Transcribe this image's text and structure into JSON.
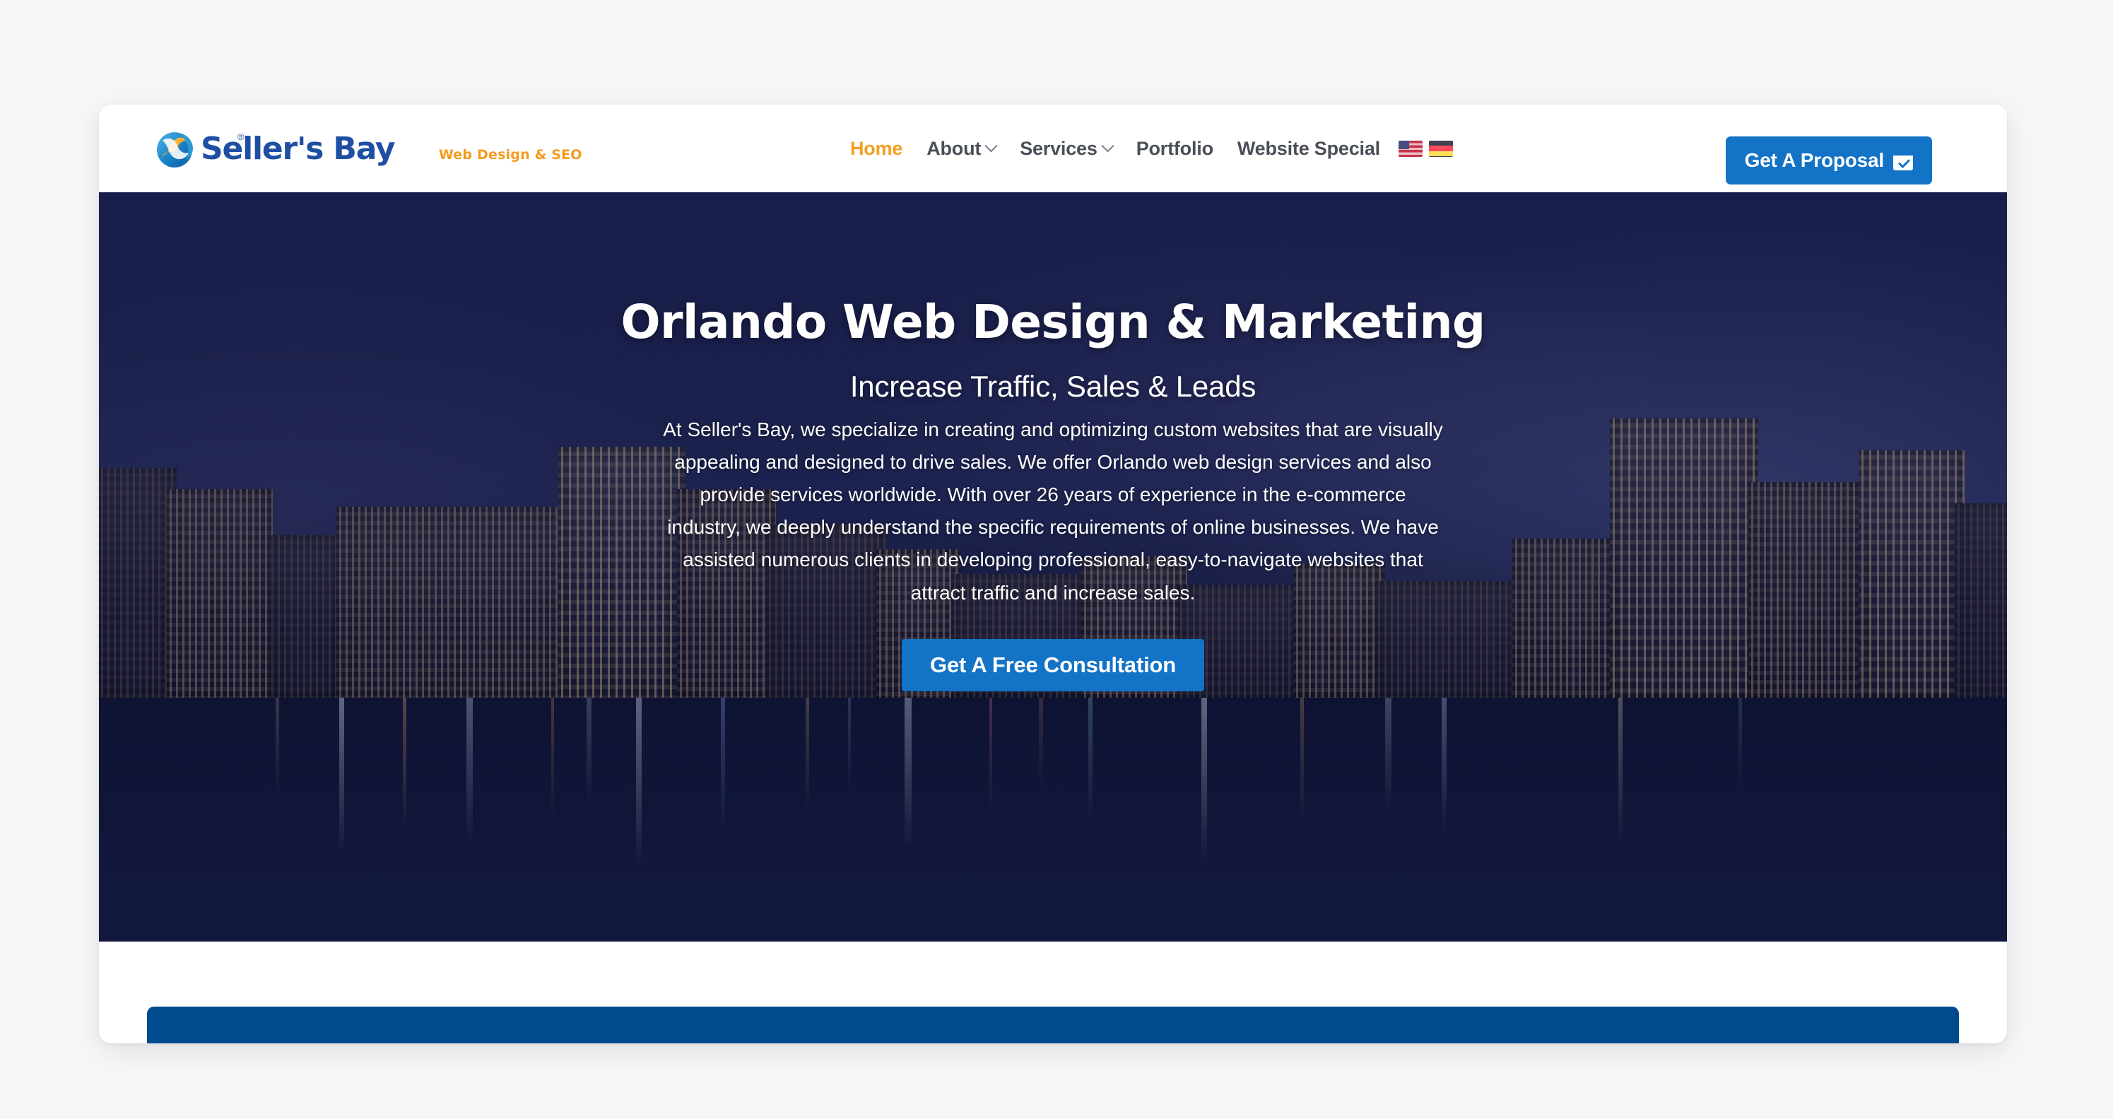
{
  "brand": {
    "name": "Seller's Bay",
    "tagline": "Web Design & SEO",
    "registered_mark": "®",
    "logo_icon": "sellers-bay-globe-swoosh",
    "name_color": "#1f4fa3",
    "tagline_color": "#f59a1e"
  },
  "header": {
    "nav": [
      {
        "label": "Home",
        "active": true,
        "has_dropdown": false
      },
      {
        "label": "About",
        "active": false,
        "has_dropdown": true
      },
      {
        "label": "Services",
        "active": false,
        "has_dropdown": true
      },
      {
        "label": "Portfolio",
        "active": false,
        "has_dropdown": false
      },
      {
        "label": "Website Special",
        "active": false,
        "has_dropdown": false
      }
    ],
    "languages": [
      {
        "name": "english",
        "icon": "us-flag-icon"
      },
      {
        "name": "german",
        "icon": "german-flag-icon"
      }
    ],
    "cta": {
      "label": "Get A Proposal",
      "icon": "calendar-check-icon",
      "color": "#1373c6"
    },
    "active_color": "#f0a020",
    "nav_color": "#4a4f58"
  },
  "hero": {
    "title": "Orlando Web Design & Marketing",
    "subtitle": "Increase Traffic, Sales & Leads",
    "paragraph": "At Seller's Bay, we specialize in creating and optimizing custom websites that are visually appealing and designed to drive sales. We offer Orlando web design services and also provide services worldwide. With over 26 years of experience in the e-commerce industry, we deeply understand the specific requirements of online businesses. We have assisted numerous clients in developing professional, easy-to-navigate websites that attract traffic and increase sales.",
    "cta_label": "Get A Free Consultation",
    "cta_color": "#1373c6",
    "scroll_icon": "chevron-down-circle-icon",
    "background_image": "orlando-downtown-skyline-at-night-reflected-in-lake-eola",
    "background_color": "#1a2150"
  },
  "next_section": {
    "band_color": "#004b8d"
  },
  "page": {
    "background_color": "#f7f7f8",
    "card_color": "#ffffff"
  }
}
